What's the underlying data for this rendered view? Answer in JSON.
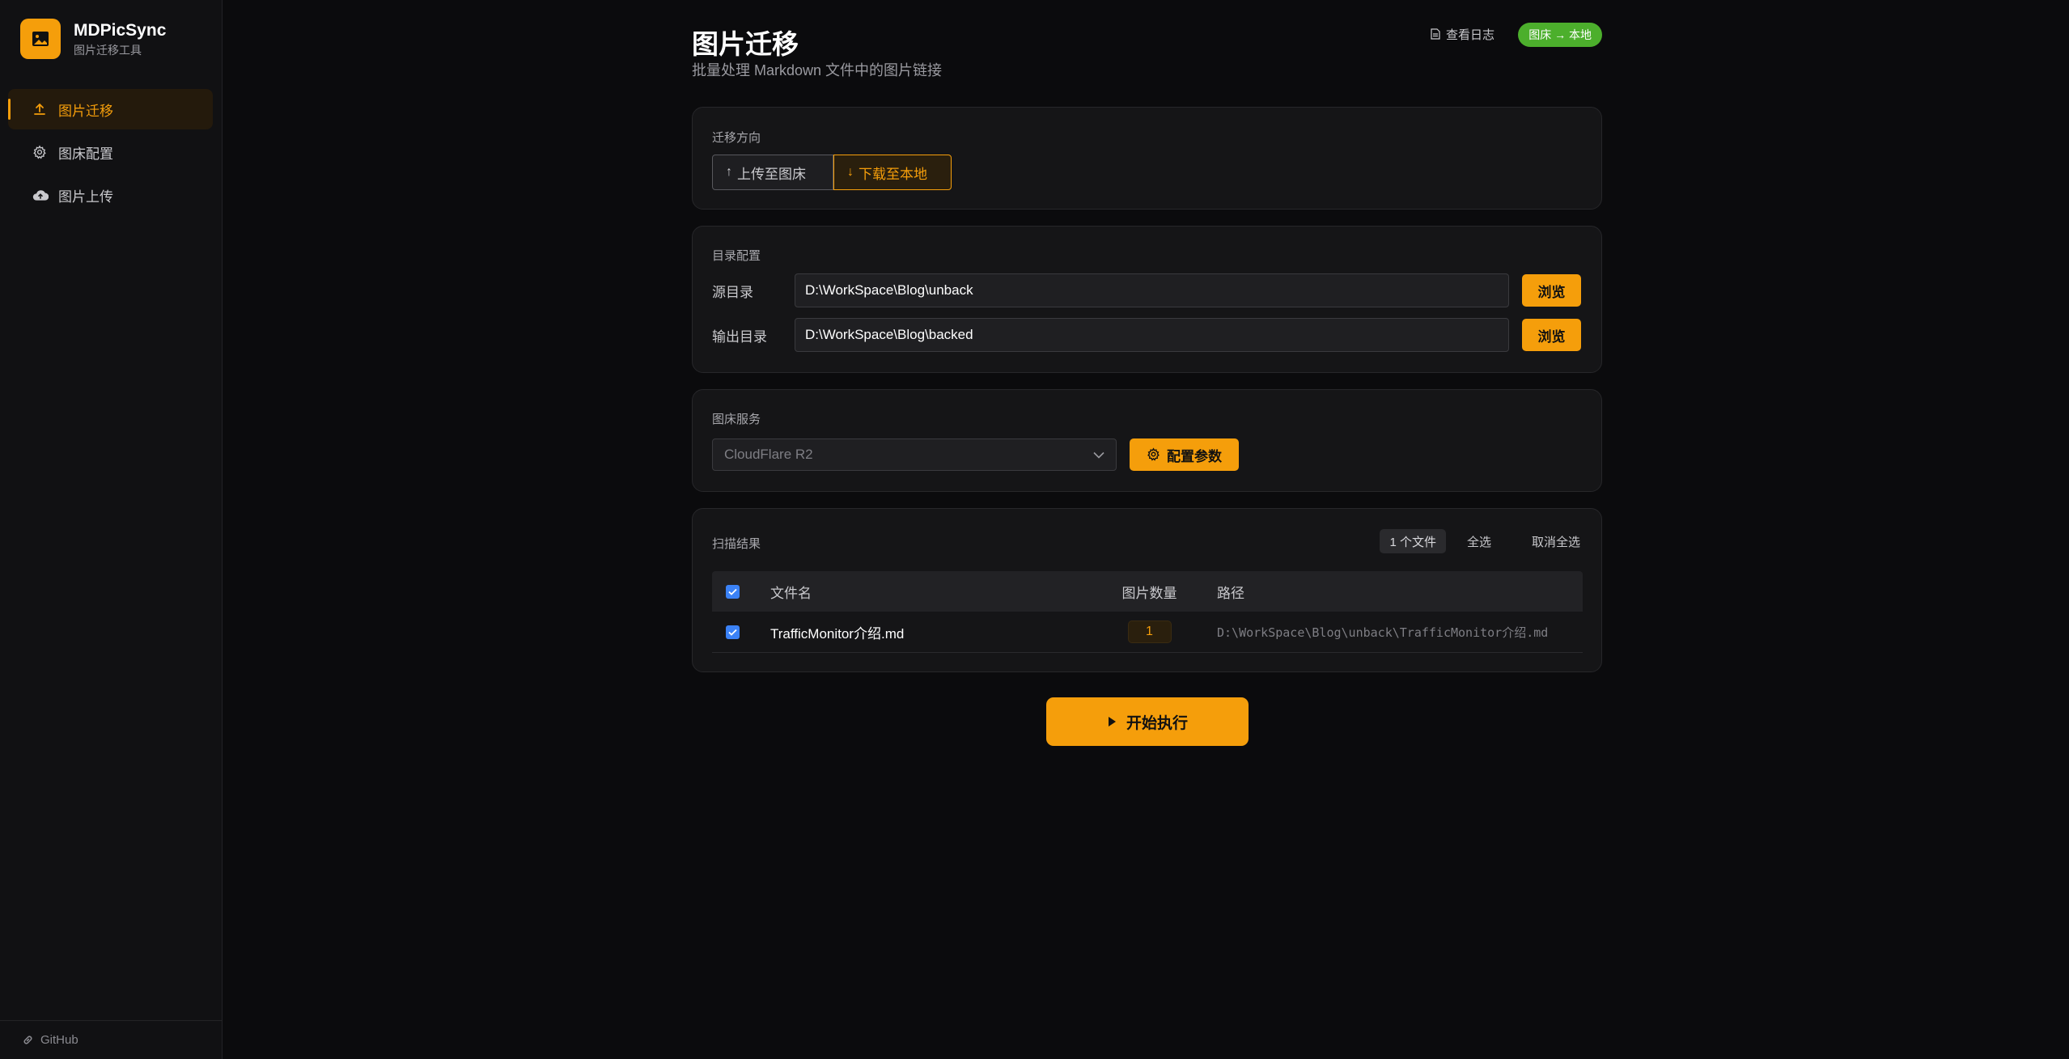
{
  "app": {
    "name": "MDPicSync",
    "subtitle": "图片迁移工具"
  },
  "sidebar": {
    "items": [
      {
        "label": "图片迁移",
        "icon": "upload-icon",
        "active": true
      },
      {
        "label": "图床配置",
        "icon": "gear-icon",
        "active": false
      },
      {
        "label": "图片上传",
        "icon": "cloud-upload-icon",
        "active": false
      }
    ],
    "footer": {
      "label": "GitHub",
      "icon": "link-icon"
    }
  },
  "header": {
    "title": "图片迁移",
    "subtitle": "批量处理 Markdown 文件中的图片链接",
    "log_link": "查看日志",
    "mode_badge": "图床 → 本地"
  },
  "direction": {
    "label": "迁移方向",
    "options": [
      {
        "label": "上传至图床",
        "icon": "arrow-up-icon",
        "selected": false
      },
      {
        "label": "下载至本地",
        "icon": "arrow-down-icon",
        "selected": true
      }
    ]
  },
  "directories": {
    "label": "目录配置",
    "source_label": "源目录",
    "source_value": "D:\\WorkSpace\\Blog\\unback",
    "output_label": "输出目录",
    "output_value": "D:\\WorkSpace\\Blog\\backed",
    "browse_label": "浏览"
  },
  "host": {
    "label": "图床服务",
    "selected": "CloudFlare R2",
    "config_button": "配置参数"
  },
  "scan": {
    "label": "扫描结果",
    "file_count": "1 个文件",
    "select_all": "全选",
    "deselect_all": "取消全选",
    "columns": [
      "文件名",
      "图片数量",
      "路径"
    ],
    "rows": [
      {
        "checked": true,
        "name": "TrafficMonitor介绍.md",
        "count": "1",
        "path": "D:\\WorkSpace\\Blog\\unback\\TrafficMonitor介绍.md"
      }
    ]
  },
  "start_button": "开始执行",
  "colors": {
    "accent": "#f59e0b",
    "badge_green": "#4caf2c",
    "checkbox_blue": "#3b82f6",
    "background": "#0b0b0d",
    "sidebar": "#111113",
    "card": "#151517"
  }
}
